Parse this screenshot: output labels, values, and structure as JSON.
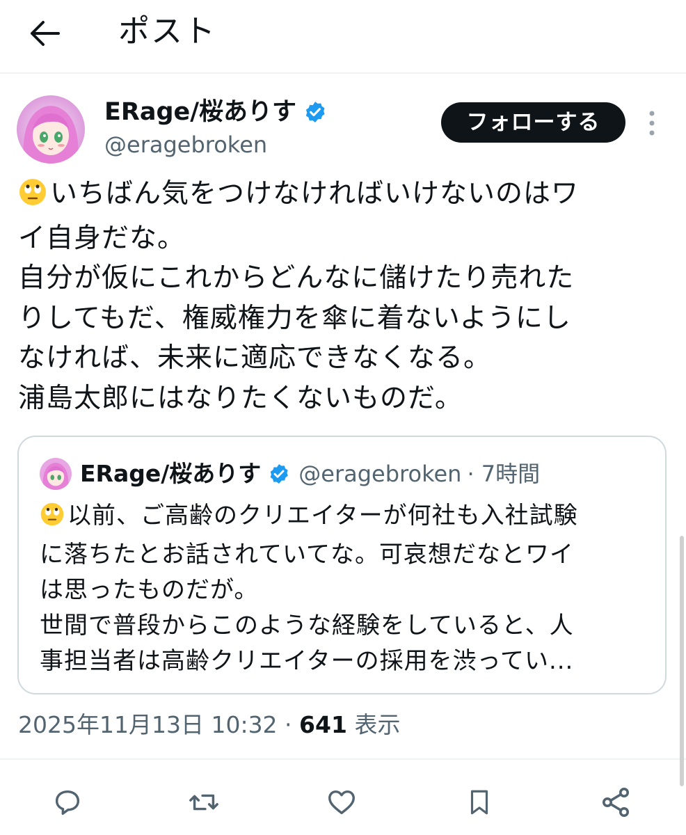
{
  "header": {
    "title": "ポスト",
    "back_icon": "arrow-left-icon"
  },
  "post": {
    "author": {
      "name": "ERage/桜ありす",
      "handle": "@eragebroken",
      "verified": true
    },
    "follow_label": "フォローする",
    "text_lines": [
      "いちばん気をつけなければいけないのはワ",
      "イ自身だな。",
      "自分が仮にこれからどんなに儲けたり売れた",
      "りしてもだ、権威権力を傘に着ないようにし",
      "なければ、未来に適応できなくなる。",
      "浦島太郎にはなりたくないものだ。"
    ],
    "leading_emoji": "🙄",
    "timestamp": "2025年11月13日 10:32",
    "separator": " · ",
    "views_count": "641",
    "views_label": "表示"
  },
  "quote": {
    "author_name": "ERage/桜ありす",
    "handle": "@eragebroken",
    "time": "· 7時間",
    "leading_emoji": "🙄",
    "text_lines": [
      "以前、ご高齢のクリエイターが何社も入社試験",
      "に落ちたとお話されていてな。可哀想だなとワイ",
      "は思ったものだが。",
      "世間で普段からこのような経験をしていると、人",
      "事担当者は高齢クリエイターの採用を渋ってい..."
    ]
  },
  "colors": {
    "text": "#0f1419",
    "muted": "#536471",
    "verified": "#1d9bf0",
    "border": "#cfd9de",
    "follow_bg": "#0f1419"
  },
  "actions": [
    "reply-icon",
    "repost-icon",
    "like-icon",
    "bookmark-icon",
    "share-icon"
  ]
}
